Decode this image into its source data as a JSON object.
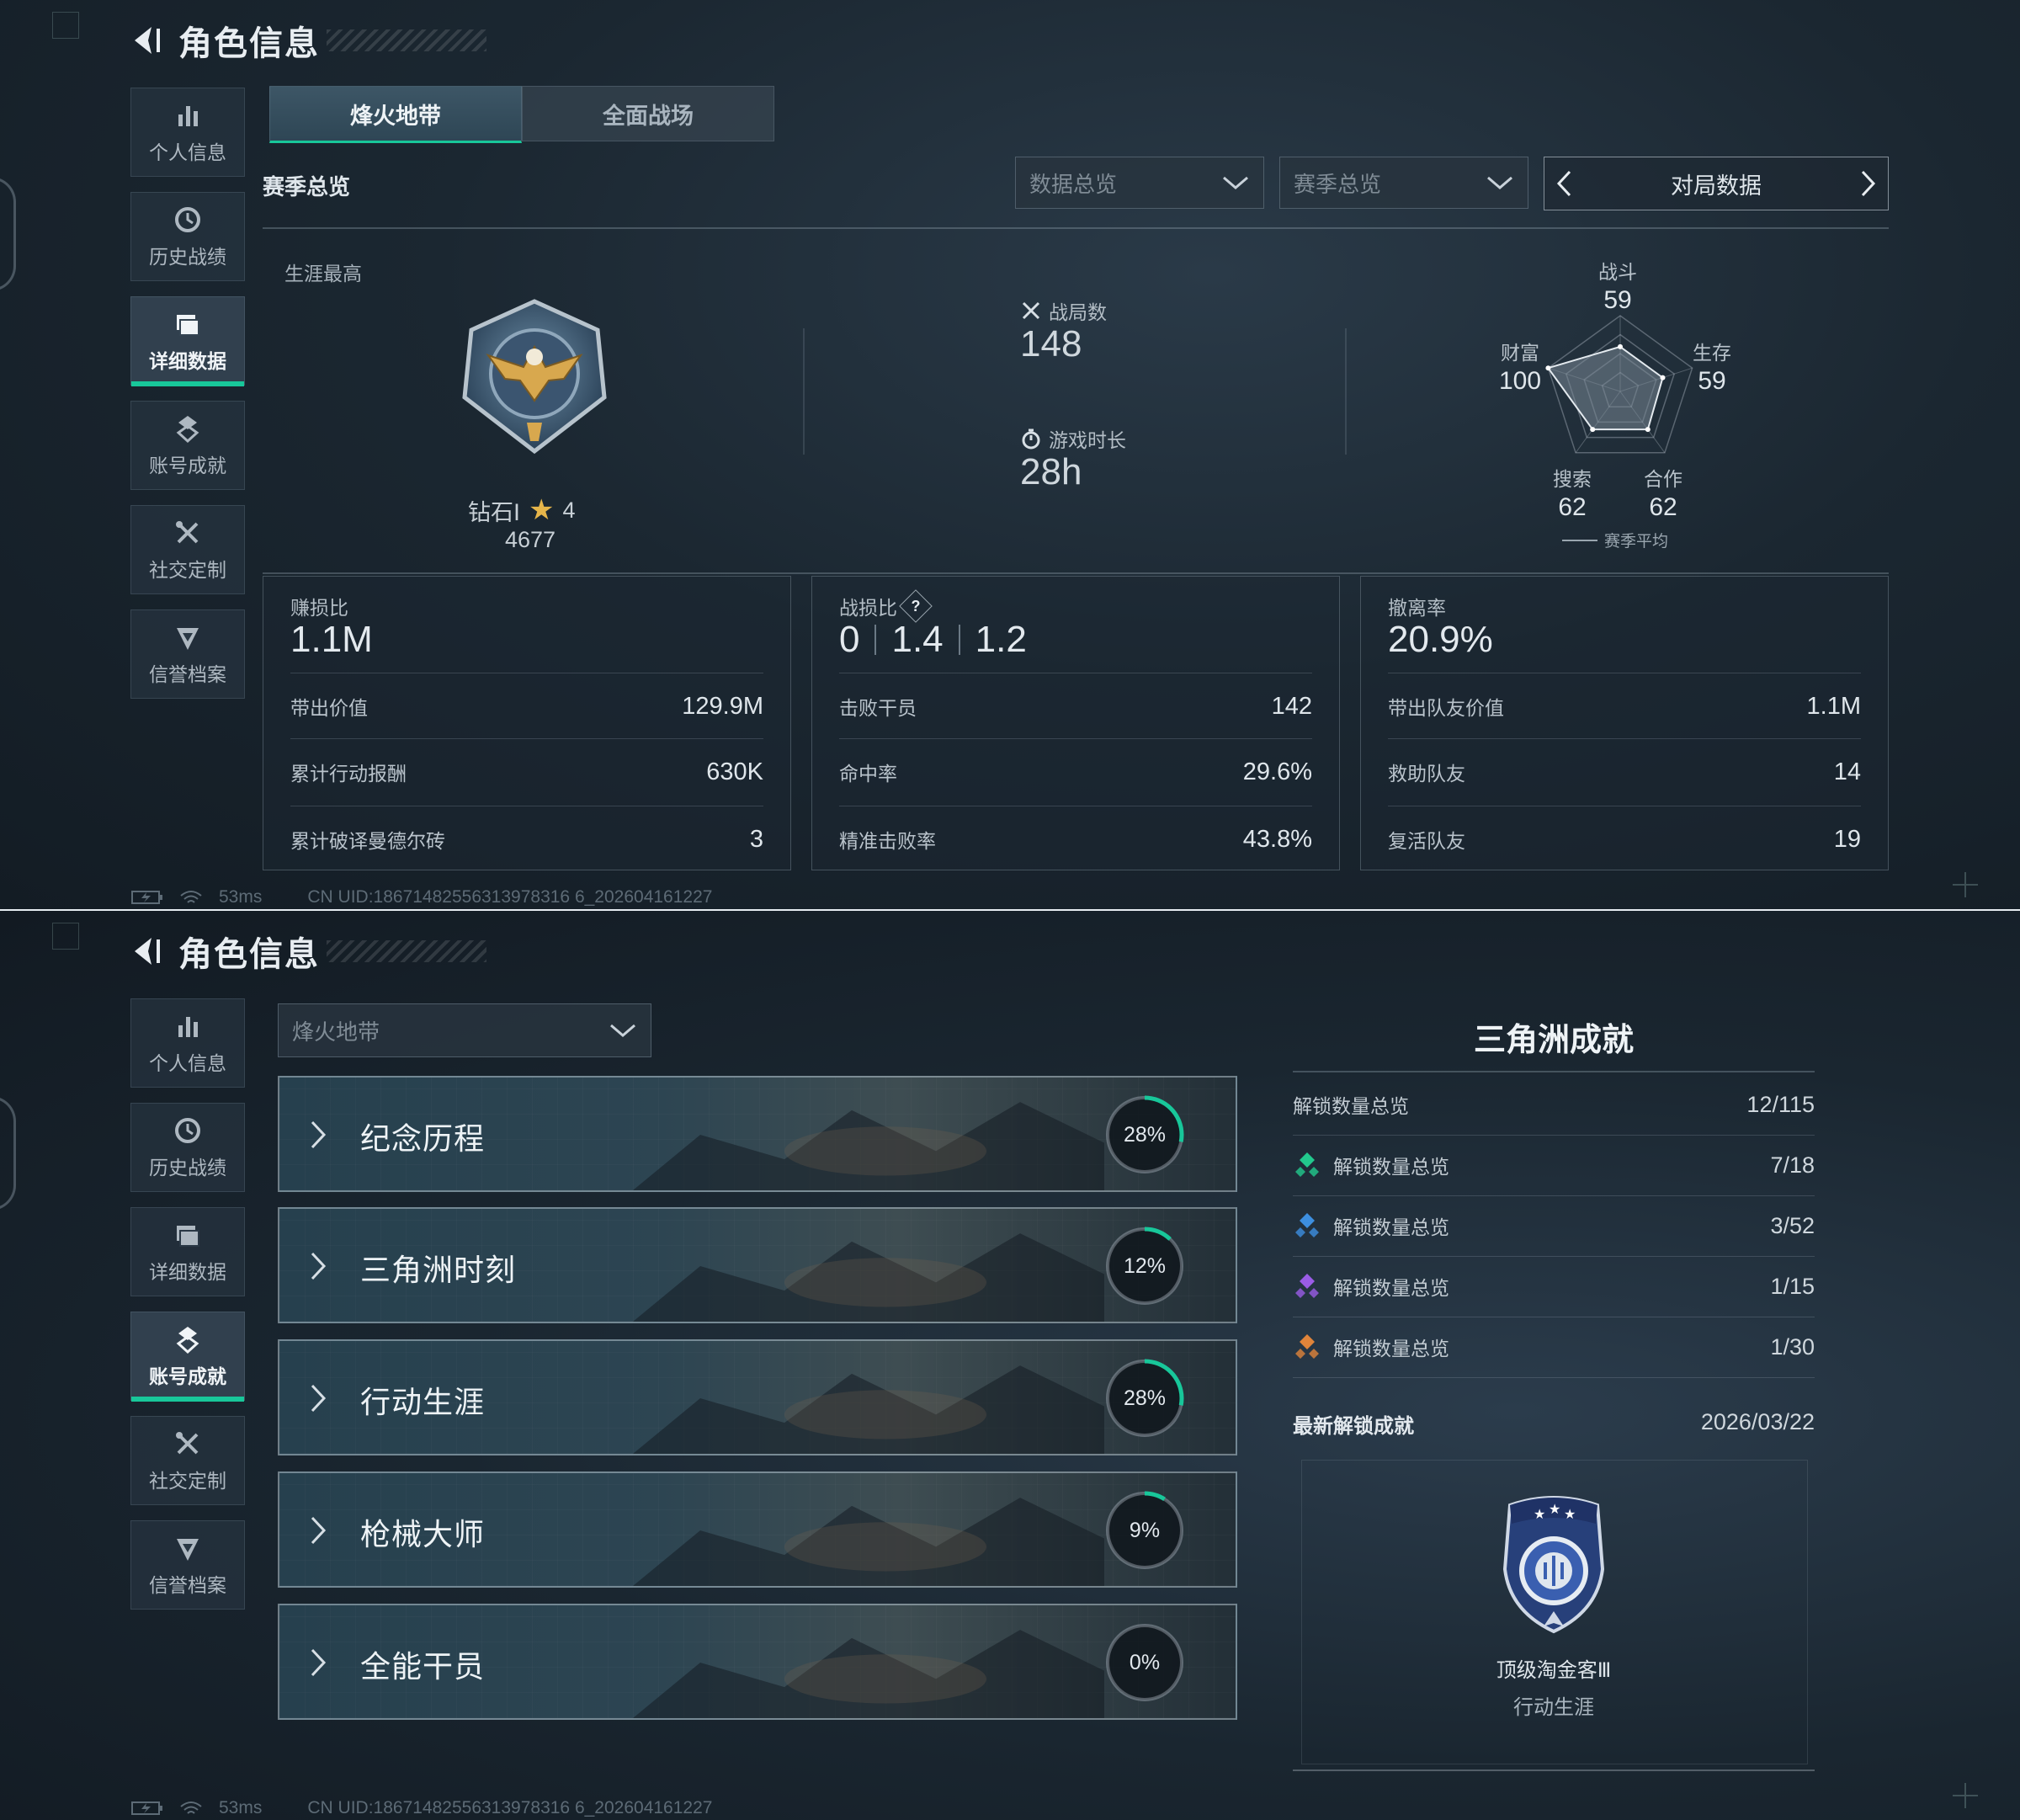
{
  "panel1": {
    "title": "角色信息",
    "nav": [
      {
        "label": "个人信息",
        "icon": "bar-chart-icon"
      },
      {
        "label": "历史战绩",
        "icon": "history-clock-icon"
      },
      {
        "label": "详细数据",
        "icon": "folder-icon"
      },
      {
        "label": "账号成就",
        "icon": "achievement-icon"
      },
      {
        "label": "社交定制",
        "icon": "crossed-tools-icon"
      },
      {
        "label": "信誉档案",
        "icon": "shield-badge-icon"
      }
    ],
    "active_nav": "详细数据",
    "tabs": [
      "烽火地带",
      "全面战场"
    ],
    "active_tab": "烽火地带",
    "section_title": "赛季总览",
    "dropdowns": {
      "data_overview": "数据总览",
      "season_overview": "赛季总览"
    },
    "pager_label": "对局数据",
    "career_best": {
      "label": "生涯最高",
      "rank_name": "钻石Ⅰ",
      "stars": "4",
      "points": "4677"
    },
    "matches": {
      "label": "战局数",
      "value": "148"
    },
    "playtime": {
      "label": "游戏时长",
      "value": "28h"
    },
    "radar": {
      "labels": {
        "combat": "战斗",
        "survival": "生存",
        "coop": "合作",
        "search": "搜索",
        "wealth": "财富"
      },
      "values": {
        "combat": 59,
        "survival": 59,
        "coop": 62,
        "search": 62,
        "wealth": 100
      },
      "display": {
        "combat": "59",
        "survival": "59",
        "coop": "62",
        "search": "62",
        "wealth": "100"
      },
      "legend": "赛季平均",
      "max": 100
    },
    "cards": [
      {
        "title": "赚损比",
        "main": "1.1M",
        "rows": [
          {
            "k": "带出价值",
            "v": "129.9M"
          },
          {
            "k": "累计行动报酬",
            "v": "630K"
          },
          {
            "k": "累计破译曼德尔砖",
            "v": "3"
          }
        ]
      },
      {
        "title": "战损比",
        "help": "?",
        "main_parts": [
          "0",
          "1.4",
          "1.2"
        ],
        "rows": [
          {
            "k": "击败干员",
            "v": "142"
          },
          {
            "k": "命中率",
            "v": "29.6%"
          },
          {
            "k": "精准击败率",
            "v": "43.8%"
          }
        ]
      },
      {
        "title": "撤离率",
        "main": "20.9%",
        "rows": [
          {
            "k": "带出队友价值",
            "v": "1.1M"
          },
          {
            "k": "救助队友",
            "v": "14"
          },
          {
            "k": "复活队友",
            "v": "19"
          }
        ]
      }
    ],
    "footer": {
      "ping": "53ms",
      "uid": "CN UID:18671482556313978316 6_202604161227"
    }
  },
  "panel2": {
    "title": "角色信息",
    "nav": [
      {
        "label": "个人信息",
        "icon": "bar-chart-icon"
      },
      {
        "label": "历史战绩",
        "icon": "history-clock-icon"
      },
      {
        "label": "详细数据",
        "icon": "folder-icon"
      },
      {
        "label": "账号成就",
        "icon": "achievement-icon"
      },
      {
        "label": "社交定制",
        "icon": "crossed-tools-icon"
      },
      {
        "label": "信誉档案",
        "icon": "shield-badge-icon"
      }
    ],
    "active_nav": "账号成就",
    "mode_dropdown": "烽火地带",
    "categories": [
      {
        "name": "纪念历程",
        "progress": 28,
        "progress_label": "28%"
      },
      {
        "name": "三角洲时刻",
        "progress": 12,
        "progress_label": "12%"
      },
      {
        "name": "行动生涯",
        "progress": 28,
        "progress_label": "28%"
      },
      {
        "name": "枪械大师",
        "progress": 9,
        "progress_label": "9%"
      },
      {
        "name": "全能干员",
        "progress": 0,
        "progress_label": "0%"
      }
    ],
    "summary": {
      "title": "三角洲成就",
      "total": {
        "label": "解锁数量总览",
        "value": "12/115"
      },
      "tiers": [
        {
          "label": "解锁数量总览",
          "value": "7/18",
          "color": "#22c98d",
          "icon": "green-diamond-icon"
        },
        {
          "label": "解锁数量总览",
          "value": "3/52",
          "color": "#3d8fe0",
          "icon": "blue-diamond-icon"
        },
        {
          "label": "解锁数量总览",
          "value": "1/15",
          "color": "#9a5ce6",
          "icon": "purple-diamond-icon"
        },
        {
          "label": "解锁数量总览",
          "value": "1/30",
          "color": "#e0843a",
          "icon": "orange-diamond-icon"
        }
      ]
    },
    "latest": {
      "label": "最新解锁成就",
      "date": "2026/03/22",
      "medal_name": "顶级淘金客Ⅲ",
      "medal_category": "行动生涯"
    },
    "footer": {
      "ping": "53ms",
      "uid": "CN UID:18671482556313978316 6_202604161227"
    }
  },
  "colors": {
    "accent": "#18c79a",
    "background": "#121c25",
    "ring_progress": "#18c79a"
  }
}
